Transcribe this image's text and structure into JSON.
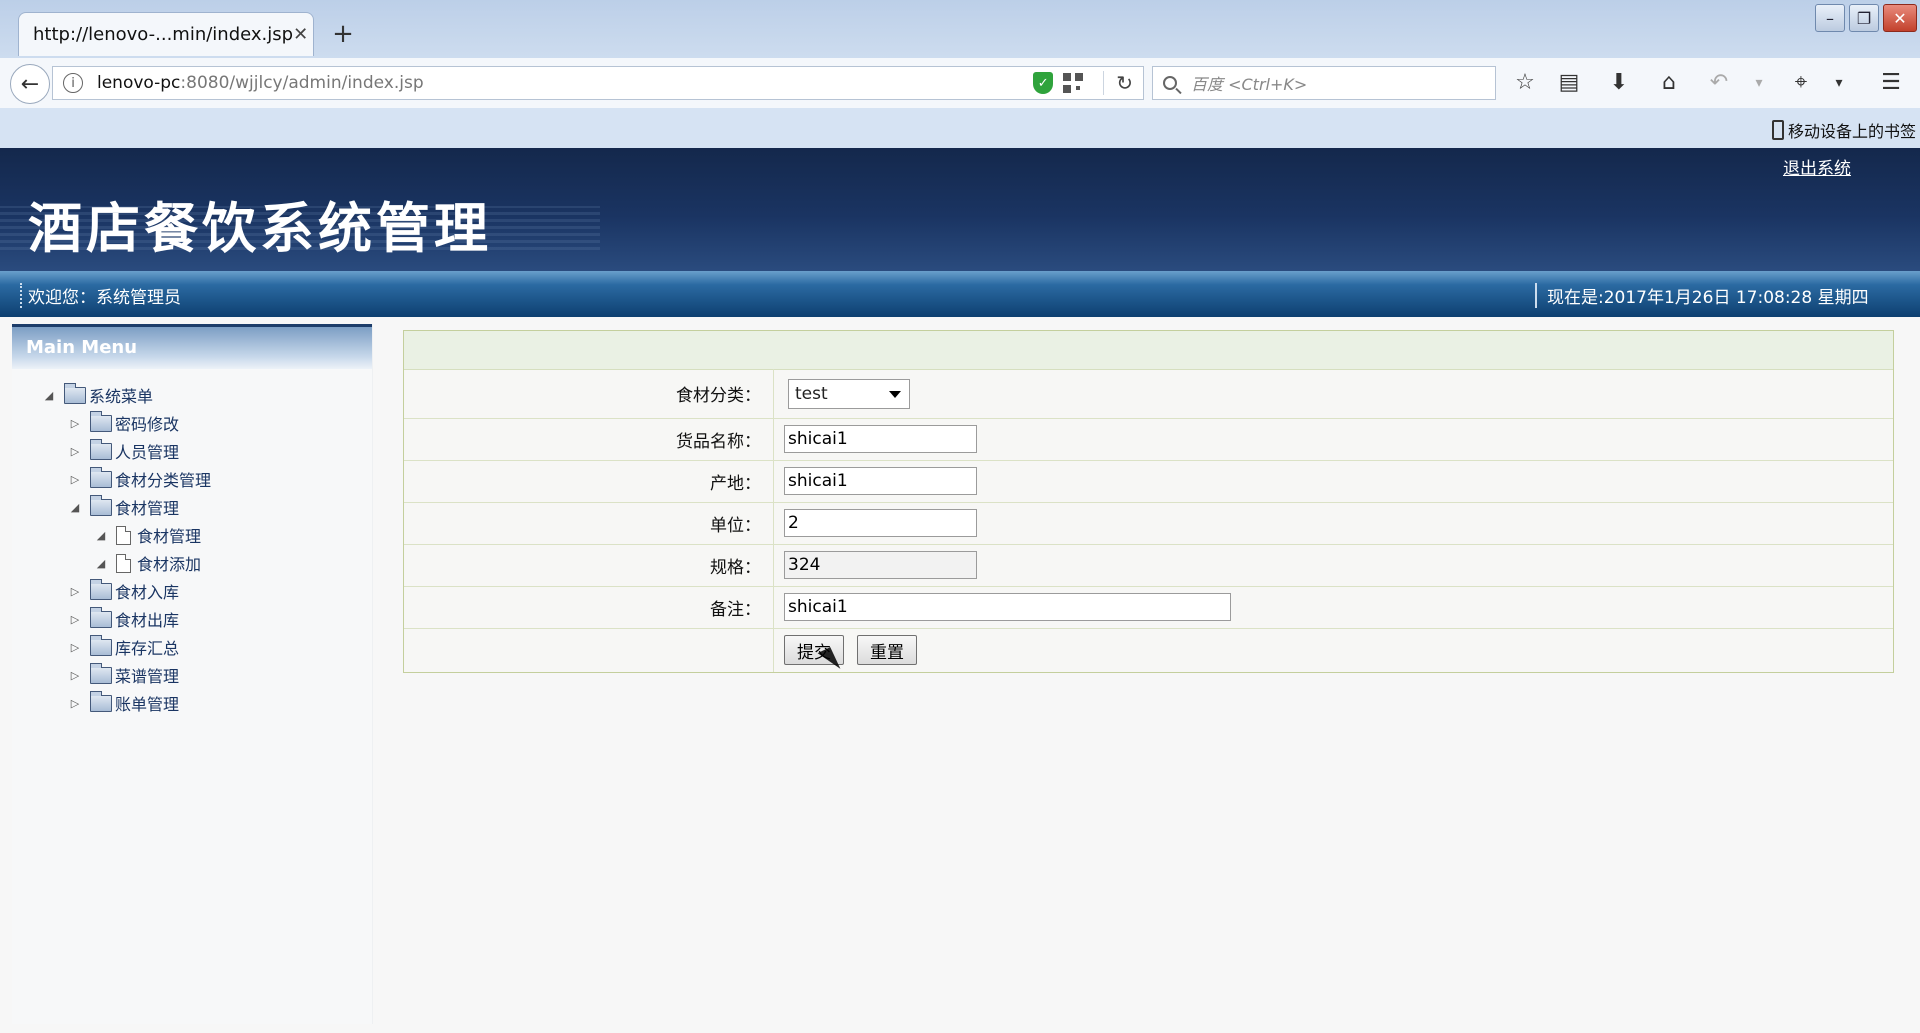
{
  "browser": {
    "tab_title": "http://lenovo-...min/index.jsp",
    "tab_close": "✕",
    "new_tab": "+",
    "url_host": "lenovo-pc",
    "url_rest": ":8080/wjjlcy/admin/index.jsp",
    "search_placeholder": "百度 <Ctrl+K>",
    "mobile_bookmarks": "移动设备上的书签",
    "icons": [
      "back-arrow-icon",
      "info-icon",
      "shield-icon",
      "qr-icon",
      "reload-icon",
      "search-icon",
      "star-icon",
      "reader-icon",
      "download-icon",
      "home-icon",
      "undo-icon",
      "crop-icon",
      "menu-icon"
    ]
  },
  "header": {
    "title": "酒店餐饮系统管理",
    "logout": "退出系统",
    "welcome": "欢迎您：系统管理员",
    "datetime": "现在是:2017年1月26日 17:08:28 星期四"
  },
  "sidebar": {
    "heading": "Main Menu",
    "root": "系统菜单",
    "items": [
      "密码修改",
      "人员管理",
      "食材分类管理",
      "食材管理",
      "食材入库",
      "食材出库",
      "库存汇总",
      "菜谱管理",
      "账单管理"
    ],
    "sub_items": [
      "食材管理",
      "食材添加"
    ]
  },
  "form": {
    "category_label": "食材分类：",
    "category_value": "test",
    "name_label": "货品名称：",
    "name_value": "shicai1",
    "origin_label": "产地：",
    "origin_value": "shicai1",
    "unit_label": "单位：",
    "unit_value": "2",
    "spec_label": "规格：",
    "spec_value": "324",
    "note_label": "备注：",
    "note_value": "shicai1",
    "submit": "提交",
    "reset": "重置"
  }
}
